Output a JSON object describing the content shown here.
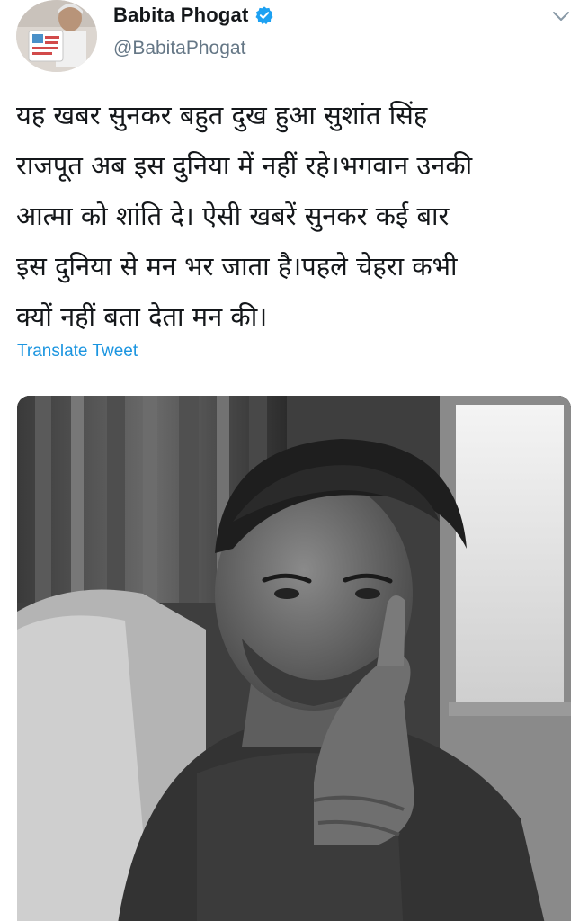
{
  "author": {
    "display_name": "Babita Phogat",
    "handle": "@BabitaPhogat",
    "verified": true
  },
  "tweet": {
    "text": "यह खबर सुनकर बहुत दुख हुआ सुशांत सिंह\nराजपूत अब इस दुनिया में नहीं रहे।भगवान उनकी\nआत्मा को शांति दे। ऐसी खबरें सुनकर कई बार\nइस दुनिया से मन भर जाता है।पहले चेहरा कभी\nक्यों नहीं बता देता मन की।",
    "translate_label": "Translate Tweet"
  },
  "icons": {
    "verified": "verified-badge-icon",
    "menu": "chevron-down-icon"
  },
  "colors": {
    "text": "#14171a",
    "secondary": "#657786",
    "link": "#1b95e0",
    "verified": "#1da1f2"
  },
  "media": {
    "type": "black-and-white portrait photo"
  }
}
